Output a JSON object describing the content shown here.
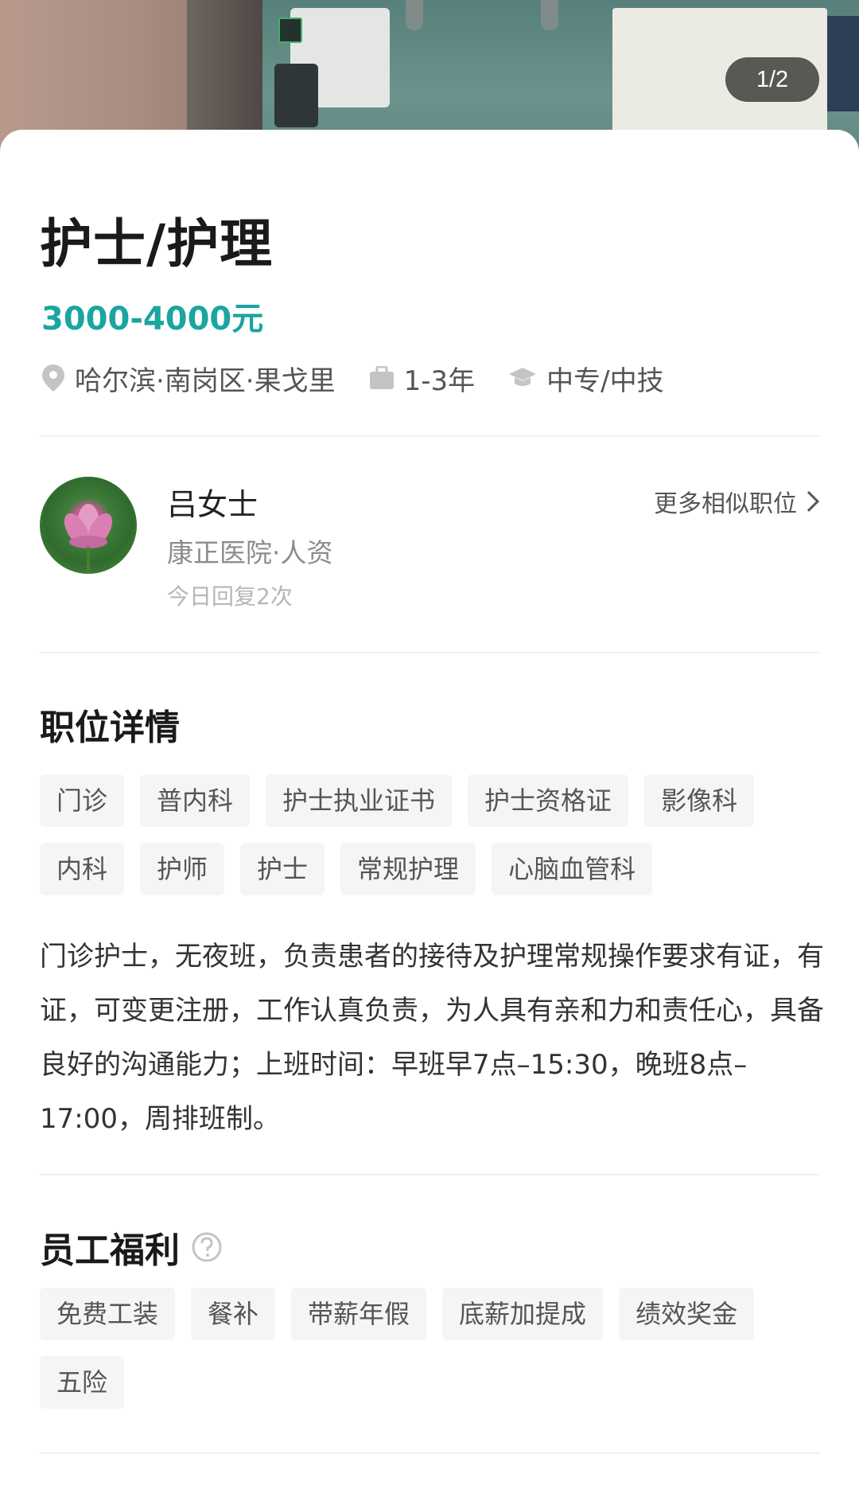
{
  "banner": {
    "counter": "1/2"
  },
  "job": {
    "title": "护士/护理",
    "salary": "3000-4000元",
    "location": "哈尔滨·南岗区·果戈里",
    "experience": "1-3年",
    "education": "中专/中技"
  },
  "recruiter": {
    "name": "吕女士",
    "company": "康正医院·人资",
    "reply": "今日回复2次",
    "more_link": "更多相似职位"
  },
  "details": {
    "title": "职位详情",
    "tags": [
      "门诊",
      "普内科",
      "护士执业证书",
      "护士资格证",
      "影像科",
      "内科",
      "护师",
      "护士",
      "常规护理",
      "心脑血管科"
    ],
    "description": "门诊护士，无夜班，负责患者的接待及护理常规操作要求有证，有证，可变更注册，工作认真负责，为人具有亲和力和责任心，具备良好的沟通能力；上班时间：早班早7点–15:30，晚班8点–17:00，周排班制。"
  },
  "benefits": {
    "title": "员工福利",
    "tags": [
      "免费工装",
      "餐补",
      "带薪年假",
      "底薪加提成",
      "绩效奖金",
      "五险"
    ]
  },
  "colors": {
    "salary": "#1aa5a0",
    "tag_bg": "#f4f5f7"
  },
  "icons": [
    "location-pin-icon",
    "briefcase-icon",
    "graduation-cap-icon",
    "chevron-right-icon",
    "help-circle-icon"
  ]
}
